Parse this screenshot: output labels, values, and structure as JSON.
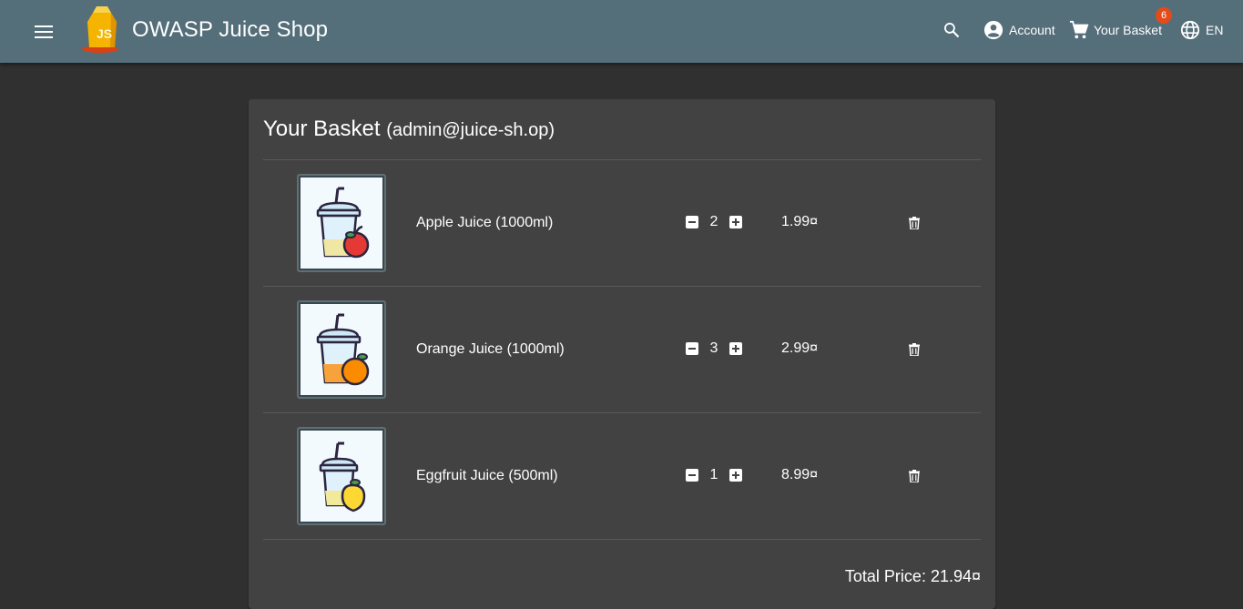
{
  "header": {
    "title": "OWASP Juice Shop",
    "account_label": "Account",
    "basket_label": "Your Basket",
    "basket_count": "6",
    "language_label": "EN"
  },
  "basket": {
    "title": "Your Basket",
    "user": "(admin@juice-sh.op)",
    "items": [
      {
        "name": "Apple Juice (1000ml)",
        "quantity": "2",
        "price": "1.99¤",
        "fruit": "apple"
      },
      {
        "name": "Orange Juice (1000ml)",
        "quantity": "3",
        "price": "2.99¤",
        "fruit": "orange"
      },
      {
        "name": "Eggfruit Juice (500ml)",
        "quantity": "1",
        "price": "8.99¤",
        "fruit": "eggfruit"
      }
    ],
    "total_label": "Total Price: 21.94¤"
  },
  "colors": {
    "toolbar": "#546e7a",
    "background": "#303030",
    "card": "#424242",
    "badge": "#e64a19"
  }
}
